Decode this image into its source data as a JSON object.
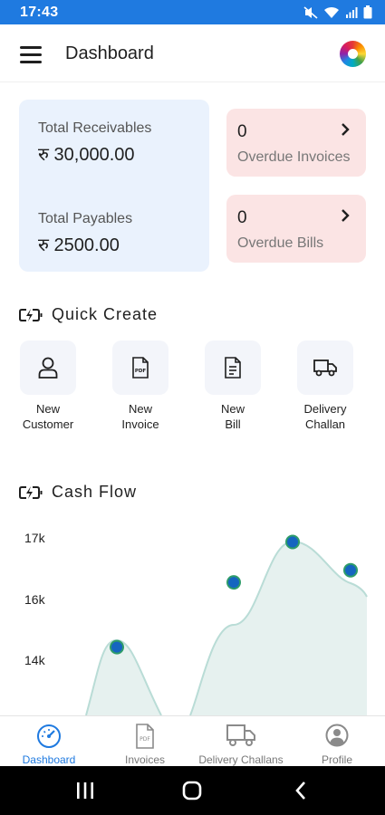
{
  "status_bar": {
    "time": "17:43"
  },
  "header": {
    "title": "Dashboard"
  },
  "totals": {
    "receivables_label": "Total Receivables",
    "receivables_value": "रु 30,000.00",
    "payables_label": "Total Payables",
    "payables_value": "रु 2500.00"
  },
  "overdue": {
    "invoices_count": "0",
    "invoices_label": "Overdue Invoices",
    "bills_count": "0",
    "bills_label": "Overdue Bills"
  },
  "quick_create": {
    "title": "Quick Create",
    "items": [
      {
        "label_line1": "New",
        "label_line2": "Customer",
        "icon": "user-icon"
      },
      {
        "label_line1": "New",
        "label_line2": "Invoice",
        "icon": "pdf-file-icon"
      },
      {
        "label_line1": "New",
        "label_line2": "Bill",
        "icon": "document-icon"
      },
      {
        "label_line1": "Delivery",
        "label_line2": "Challan",
        "icon": "truck-icon"
      }
    ]
  },
  "cash_flow": {
    "title": "Cash Flow"
  },
  "chart_data": {
    "type": "area",
    "ytick_labels": [
      "17k",
      "16k",
      "14k"
    ],
    "points_visible": [
      14.3,
      15.9,
      16.9,
      16.2
    ],
    "fill_color": "#e6f1ef",
    "line_color": "#b9dcd6",
    "point_color": "#1565c0"
  },
  "bottom_nav": {
    "items": [
      {
        "label": "Dashboard",
        "icon": "speedometer-icon",
        "active": true
      },
      {
        "label": "Invoices",
        "icon": "pdf-file-icon",
        "active": false
      },
      {
        "label": "Delivery Challans",
        "icon": "truck-icon",
        "active": false
      },
      {
        "label": "Profile",
        "icon": "profile-icon",
        "active": false
      }
    ]
  },
  "colors": {
    "accent": "#1f7ae0",
    "totals_card_bg": "#eaf2fd",
    "overdue_card_bg": "#fbe4e4"
  }
}
